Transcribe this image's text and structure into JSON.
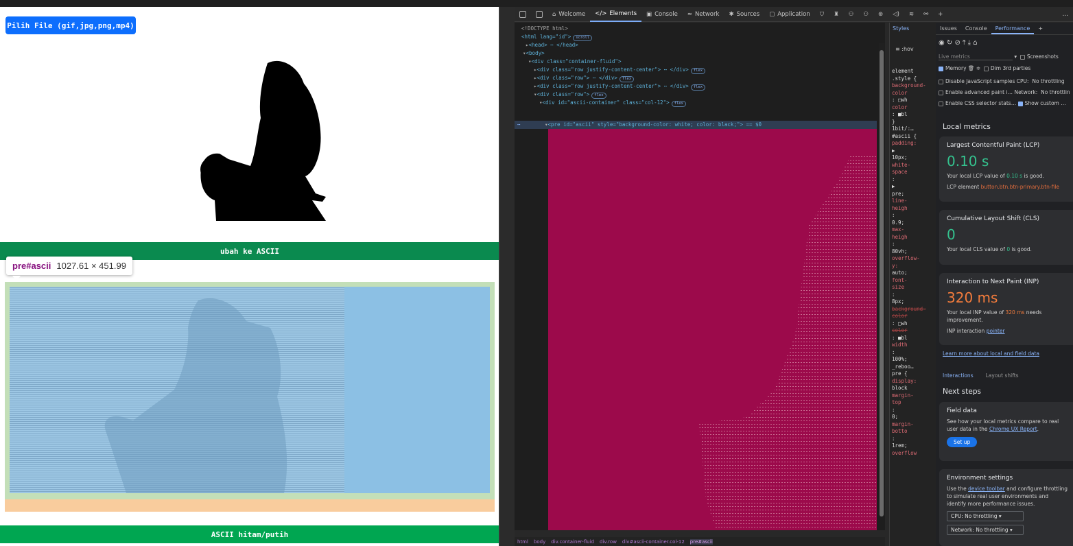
{
  "page": {
    "choose_file_label": "Pilih File (gif,jpg,png,mp4)",
    "convert_bar_label": "ubah ke ASCII",
    "bw_bar_label": "ASCII hitam/putih",
    "tooltip_selector": "pre#ascii",
    "tooltip_size": "1027.61 × 451.99"
  },
  "devtools": {
    "tabs": [
      {
        "label": "Welcome",
        "icon": "home-icon"
      },
      {
        "label": "Elements",
        "icon": "code-icon"
      },
      {
        "label": "Console",
        "icon": "console-icon"
      },
      {
        "label": "Network",
        "icon": "wifi-icon"
      },
      {
        "label": "Sources",
        "icon": "bug-icon"
      },
      {
        "label": "Application",
        "icon": "app-icon"
      }
    ],
    "dom_lines": [
      "<!DOCTYPE html>",
      "<html lang=\"id\">",
      "<head> ⋯ </head>",
      "<body>",
      "<div class=\"container-fluid\">",
      "<div class=\"row justify-content-center\"> ⋯ </div>",
      "<div class=\"row\"> ⋯ </div>",
      "<div class=\"row justify-content-center\"> ⋯ </div>",
      "<div class=\"row\">",
      "<div id=\"ascii-container\" class=\"col-12\">",
      "<pre id=\"ascii\" style=\"background-color: white; color: black;\"> == $0"
    ],
    "dom_badges": [
      "scroll",
      "flex",
      "flex",
      "flex",
      "flex",
      "flex"
    ],
    "breadcrumbs": [
      "html",
      "body",
      "div.container-fluid",
      "div.row",
      "div#ascii-container.col-12",
      "pre#ascii"
    ],
    "styles": {
      "tab": "Styles",
      "filter": ":hov",
      "lines": [
        "element",
        ".style {",
        "background-",
        "color",
        ": □wh",
        "color",
        ": ■bl",
        "}",
        "1bit/:…",
        "#ascii {",
        "padding:",
        "▶",
        "10px;",
        "white-",
        "space",
        ":",
        "▶",
        "pre;",
        "line-",
        "heigh",
        ":",
        "0.9;",
        "max-",
        "heigh",
        ":",
        "80vh;",
        "overflow-",
        "y:",
        "auto;",
        "font-",
        "size",
        ":",
        "8px;",
        "background-",
        "color",
        ": □wh",
        "color",
        ": ■bl",
        "width",
        ":",
        "100%;",
        "_reboo…",
        "pre {",
        "display:",
        "block",
        "margin-",
        "top",
        ":",
        "0;",
        "margin-",
        "botto",
        ":",
        "1rem;",
        "overflow"
      ]
    },
    "drawer": {
      "tabs": [
        "Issues",
        "Console",
        "Performance"
      ],
      "active_tab": "Performance",
      "live_metrics_select": "Live metrics",
      "screenshots_label": "Screenshots",
      "memory_label": "Memory",
      "dim_3rd_label": "Dim 3rd parties",
      "disable_js_label": "Disable JavaScript samples",
      "cpu_label": "CPU:",
      "cpu_value": "No throttling",
      "adv_paint_label": "Enable advanced paint i…",
      "network_label": "Network:",
      "network_value": "No throttlin",
      "css_sel_label": "Enable CSS selector stats…",
      "show_custom_label": "Show custom …",
      "local_metrics_title": "Local metrics",
      "lcp": {
        "title": "Largest Contentful Paint (LCP)",
        "value": "0.10 s",
        "desc_pre": "Your local LCP value of",
        "desc_val": "0.10 s",
        "desc_post": "is good.",
        "element_label": "LCP element",
        "element_value": "button.btn.btn-primary.btn-file"
      },
      "cls": {
        "title": "Cumulative Layout Shift (CLS)",
        "value": "0",
        "desc_pre": "Your local CLS value of",
        "desc_val": "0",
        "desc_post": "is good."
      },
      "inp": {
        "title": "Interaction to Next Paint (INP)",
        "value": "320 ms",
        "desc_pre": "Your local INP value of",
        "desc_val": "320 ms",
        "desc_post": "needs improvement.",
        "interaction_label": "INP interaction",
        "interaction_value": "pointer"
      },
      "learn_more": "Learn more about local and field data",
      "subtabs": [
        "Interactions",
        "Layout shifts"
      ],
      "next_steps_title": "Next steps",
      "field_data": {
        "title": "Field data",
        "text_pre": "See how your local metrics compare to real user data in the",
        "text_link": "Chrome UX Report",
        "button": "Set up"
      },
      "env": {
        "title": "Environment settings",
        "text_pre": "Use the",
        "text_link": "device toolbar",
        "text_post": "and configure throttling to simulate real user environments and identify more performance issues.",
        "cpu_select": "CPU: No throttling",
        "net_select": "Network: No throttling"
      }
    }
  },
  "colors": {
    "choose_button": "#0d6efd",
    "green_bar": "#0a8a4f",
    "pre_highlight": "#9c0a4b",
    "lcp_good": "#34c38f",
    "inp_warn": "#f47c3c"
  }
}
